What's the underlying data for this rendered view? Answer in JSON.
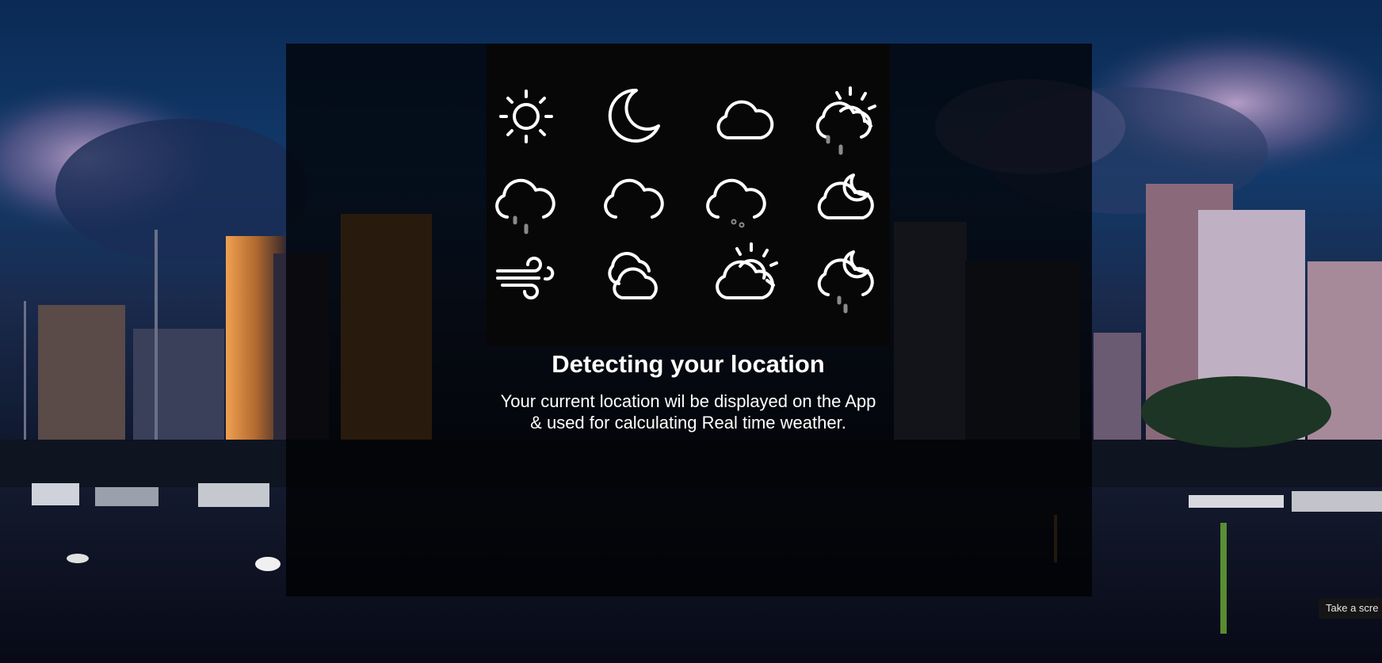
{
  "onboarding": {
    "title": "Detecting your location",
    "description_line1": "Your current location wil be displayed on the App",
    "description_line2": "& used for calculating Real time weather."
  },
  "icons": [
    "sun-icon",
    "moon-icon",
    "cloud-icon",
    "partly-sunny-rain-icon",
    "cloud-rain-icon",
    "cloud-icon",
    "cloud-drizzle-icon",
    "partly-cloudy-night-icon",
    "wind-icon",
    "clouds-icon",
    "partly-sunny-icon",
    "night-rain-icon"
  ],
  "colors": {
    "icon_stroke": "#ffffff",
    "icon_panel": "#070707",
    "overlay": "rgba(0,0,0,0.74)",
    "text": "#ffffff"
  },
  "tooltip": {
    "label": "Take a scre"
  }
}
